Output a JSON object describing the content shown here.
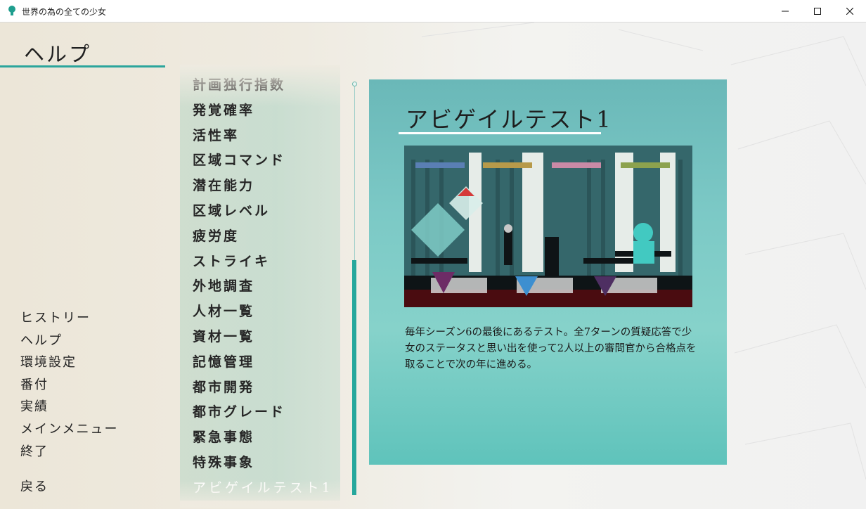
{
  "window": {
    "title": "世界の為の全ての少女",
    "controls": {
      "minimize_icon": "minimize-icon",
      "maximize_icon": "maximize-icon",
      "close_icon": "close-icon"
    }
  },
  "screen": {
    "title": "ヘルプ"
  },
  "main_menu": {
    "items": [
      "ヒストリー",
      "ヘルプ",
      "環境設定",
      "番付",
      "実績",
      "メインメニュー",
      "終了"
    ],
    "back": "戻る"
  },
  "topics": {
    "items": [
      "計画独行指数",
      "発覚確率",
      "活性率",
      "区域コマンド",
      "潜在能力",
      "区域レベル",
      "疲労度",
      "ストライキ",
      "外地調査",
      "人材一覧",
      "資材一覧",
      "記憶管理",
      "都市開発",
      "都市グレード",
      "緊急事態",
      "特殊事象",
      "アビゲイルテスト1"
    ],
    "selected": "アビゲイルテスト1"
  },
  "content": {
    "title": "アビゲイルテスト1",
    "description": "毎年シーズン6の最後にあるテスト。全7ターンの質疑応答で少女のステータスと思い出を使って2人以上の審問官から合格点を取ることで次の年に進める。"
  },
  "colors": {
    "accent": "#2ba59c",
    "panel_teal": "#6cc4bd",
    "list_panel": "#b4d8c9",
    "background": "#efebe1"
  }
}
